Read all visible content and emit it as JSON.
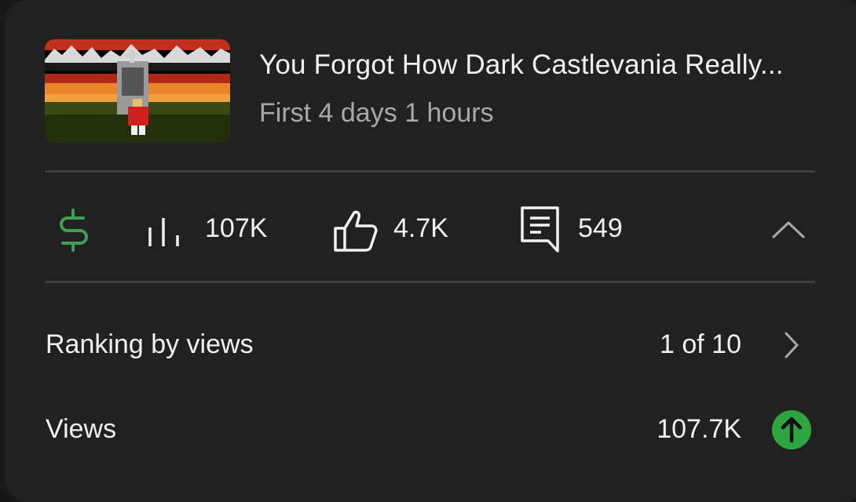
{
  "video": {
    "title": "You Forgot How Dark Castlevania Really...",
    "period": "First 4 days 1 hours"
  },
  "stats": {
    "revenue_icon": "dollar-icon",
    "views_icon": "bar-chart-icon",
    "views": "107K",
    "likes_icon": "thumbs-up-icon",
    "likes": "4.7K",
    "comments_icon": "comment-icon",
    "comments": "549",
    "collapse_icon": "chevron-up-icon"
  },
  "details": [
    {
      "label": "Ranking by views",
      "value": "1 of 10",
      "icon": "chevron-right-icon"
    },
    {
      "label": "Views",
      "value": "107.7K",
      "icon": "arrow-up-circle-icon"
    }
  ],
  "colors": {
    "revenue_green": "#3ea055",
    "up_badge_green": "#2ba640"
  }
}
